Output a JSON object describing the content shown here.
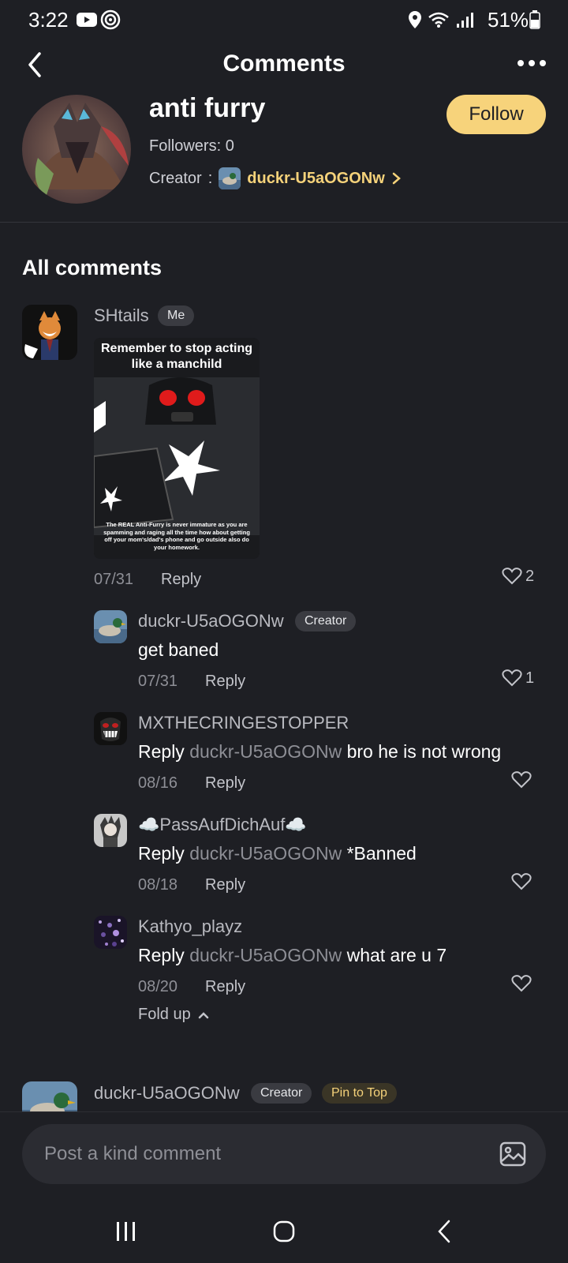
{
  "status_bar": {
    "time": "3:22",
    "battery": "51%",
    "icons": [
      "youtube-icon",
      "radar-icon",
      "location-icon",
      "wifi-icon",
      "signal-icon",
      "battery-icon"
    ]
  },
  "header": {
    "title": "Comments"
  },
  "profile": {
    "name": "anti furry",
    "followers": "Followers: 0",
    "creator_label": "Creator",
    "creator_sep": ":",
    "creator_name": "duckr-U5aOGONw",
    "follow_label": "Follow"
  },
  "section_title": "All comments",
  "main_comment": {
    "username": "SHtails",
    "badge": "Me",
    "meme": {
      "top_text_line1": "Remember to stop acting",
      "top_text_line2": "like a manchild",
      "bottom_text_line1": "The REAL Anti-Furry is never immature as you are",
      "bottom_text_line2": "spamming and raging all the time how about getting",
      "bottom_text_line3": "off your mom's/dad's phone and go outside also do",
      "bottom_text_line4": "your homework."
    },
    "date": "07/31",
    "reply_label": "Reply",
    "likes": "2"
  },
  "replies": [
    {
      "username": "duckr-U5aOGONw",
      "badge": "Creator",
      "prefix": "",
      "mention": "",
      "text": "get baned",
      "date": "07/31",
      "reply_label": "Reply",
      "likes": "1"
    },
    {
      "username": "MXTHECRINGESTOPPER",
      "badge": "",
      "prefix": "Reply",
      "mention": "duckr-U5aOGONw",
      "text": "bro he is not wrong",
      "date": "08/16",
      "reply_label": "Reply",
      "likes": ""
    },
    {
      "username": "☁️PassAufDichAuf☁️",
      "badge": "",
      "prefix": "Reply",
      "mention": "duckr-U5aOGONw",
      "text": "*Banned",
      "date": "08/18",
      "reply_label": "Reply",
      "likes": ""
    },
    {
      "username": "Kathyo_playz",
      "badge": "",
      "prefix": "Reply",
      "mention": "duckr-U5aOGONw",
      "text": "what are u 7",
      "date": "08/20",
      "reply_label": "Reply",
      "likes": ""
    }
  ],
  "fold_up_label": "Fold up",
  "next_comment": {
    "username": "duckr-U5aOGONw",
    "badge": "Creator",
    "pin_badge": "Pin to Top"
  },
  "input": {
    "placeholder": "Post a kind comment"
  },
  "colors": {
    "background": "#1e1f24",
    "accent": "#f7d37b",
    "muted_text": "#8e8f96"
  }
}
